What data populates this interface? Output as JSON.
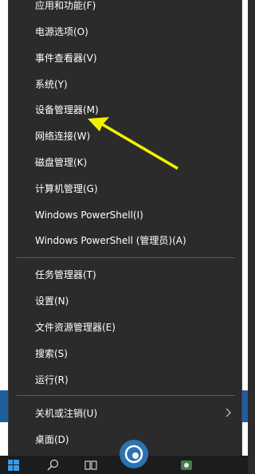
{
  "menu": {
    "items": [
      {
        "label": "应用和功能(F)"
      },
      {
        "label": "电源选项(O)"
      },
      {
        "label": "事件查看器(V)"
      },
      {
        "label": "系统(Y)"
      },
      {
        "label": "设备管理器(M)"
      },
      {
        "label": "网络连接(W)"
      },
      {
        "label": "磁盘管理(K)"
      },
      {
        "label": "计算机管理(G)"
      },
      {
        "label": "Windows PowerShell(I)"
      },
      {
        "label": "Windows PowerShell (管理员)(A)"
      },
      {
        "label": "任务管理器(T)"
      },
      {
        "label": "设置(N)"
      },
      {
        "label": "文件资源管理器(E)"
      },
      {
        "label": "搜索(S)"
      },
      {
        "label": "运行(R)"
      },
      {
        "label": "关机或注销(U)"
      },
      {
        "label": "桌面(D)"
      }
    ]
  },
  "annotation": {
    "color": "#f2f200"
  },
  "colors": {
    "menu_bg": "#2b2b2b",
    "text": "#ffffff",
    "separator": "#5a5a5a",
    "taskbar": "#1c1c1c"
  }
}
